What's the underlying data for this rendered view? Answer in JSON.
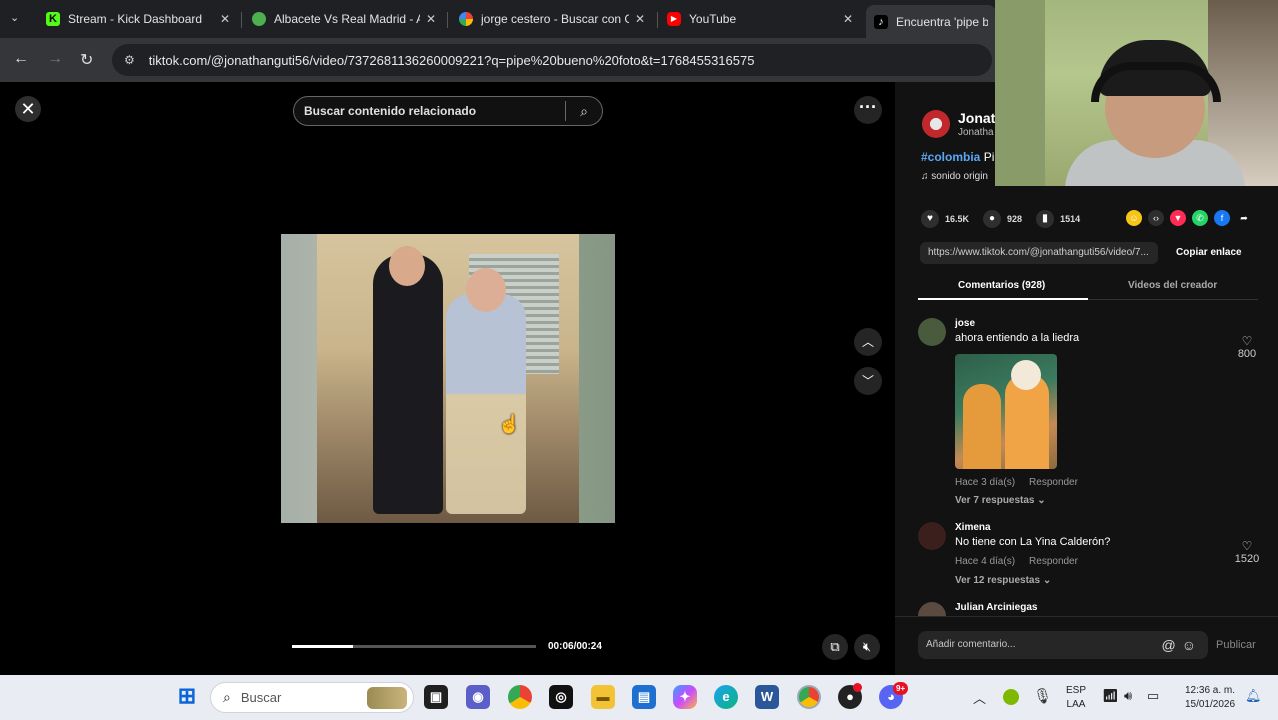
{
  "browser": {
    "tabs": [
      {
        "title": "Stream - Kick Dashboard",
        "favicon_color": "#53fc18",
        "favicon": "kick-icon"
      },
      {
        "title": "Albacete Vs Real Madrid - Al",
        "favicon_color": "#4caf50",
        "favicon": "soccer-icon"
      },
      {
        "title": "jorge cestero - Buscar con G",
        "favicon_color": "#4285f4",
        "favicon": "google-icon"
      },
      {
        "title": "YouTube",
        "favicon_color": "#ff0000",
        "favicon": "youtube-icon"
      },
      {
        "title": "Encuentra 'pipe bue",
        "favicon_color": "#ffffff",
        "favicon": "tiktok-icon"
      }
    ],
    "url": "tiktok.com/@jonathanguti56/video/7372681136260009221?q=pipe%20bueno%20foto&t=1768455316575"
  },
  "video": {
    "search_placeholder": "Buscar contenido relacionado",
    "progress": 0.25,
    "time": "00:06/00:24"
  },
  "author": {
    "name": "Jonath",
    "username": "Jonatha",
    "description_tag": "#colombia",
    "description_rest": " Pip",
    "sound": "♫  sonido origin"
  },
  "stats": {
    "likes": "16.5K",
    "comments": "928",
    "saves": "1514"
  },
  "share": {
    "link": "https://www.tiktok.com/@jonathanguti56/video/7...",
    "copy_label": "Copiar enlace",
    "icons": [
      {
        "name": "coin-icon",
        "color": "#f5c518",
        "glyph": "☺"
      },
      {
        "name": "embed-icon",
        "color": "#2e2e2e",
        "glyph": "‹›"
      },
      {
        "name": "send-icon",
        "color": "#fe2c55",
        "glyph": "▼"
      },
      {
        "name": "whatsapp-icon",
        "color": "#25d366",
        "glyph": "✆"
      },
      {
        "name": "facebook-icon",
        "color": "#1877f2",
        "glyph": "f"
      },
      {
        "name": "share-arrow-icon",
        "color": "#121212",
        "glyph": "➦"
      }
    ]
  },
  "panel_tabs": {
    "comments": "Comentarios (928)",
    "creator_videos": "Videos del creador"
  },
  "comments": [
    {
      "user": "jose",
      "text": "ahora entiendo a la liedra",
      "likes": "800",
      "time": "Hace 3 día(s)",
      "reply": "Responder",
      "replies": "Ver 7 respuestas ⌄"
    },
    {
      "user": "Ximena",
      "text": "No tiene con La Yina Calderón?",
      "likes": "1520",
      "time": "Hace 4 día(s)",
      "reply": "Responder",
      "replies": "Ver 12 respuestas ⌄"
    },
    {
      "user": "Julian Arciniegas"
    }
  ],
  "comment_input": {
    "placeholder": "Añadir comentario...",
    "publish": "Publicar"
  },
  "taskbar": {
    "search": "Buscar",
    "lang_top": "ESP",
    "lang_bottom": "LAA",
    "clock_time": "12:36 a. m.",
    "clock_date": "15/01/2026",
    "chrome_badge": "",
    "discord_badge": "9+"
  }
}
